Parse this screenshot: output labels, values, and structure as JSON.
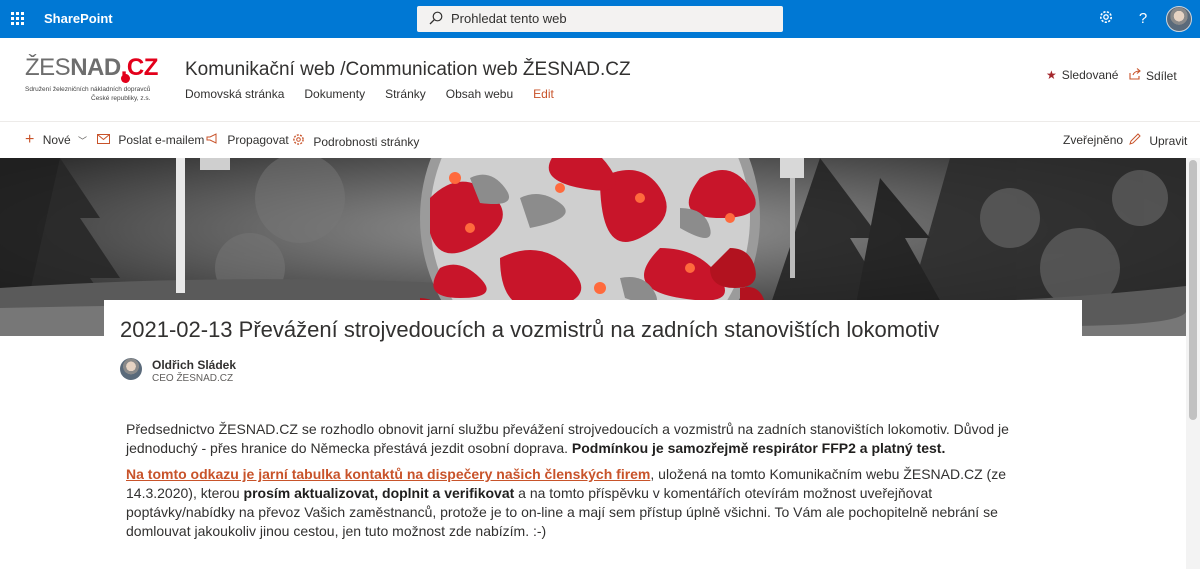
{
  "suite_bar": {
    "brand": "SharePoint",
    "search_placeholder": "Prohledat tento web",
    "settings_icon": "gear-icon",
    "help_label": "?",
    "color": "#0078d4"
  },
  "site": {
    "logo": {
      "main_a": "ŽES",
      "main_b": "NAD",
      "main_c": ".CZ",
      "subtitle_line1": "Sdružení železničních nákladních dopravců",
      "subtitle_line2": "České republiky, z.s."
    },
    "title": "Komunikační web /Communication web ŽESNAD.CZ",
    "nav": [
      "Domovská stránka",
      "Dokumenty",
      "Stránky",
      "Obsah webu"
    ],
    "nav_edit": "Edit",
    "follow_label": "Sledované",
    "share_label": "Sdílet"
  },
  "command_bar": {
    "new_label": "Nové",
    "email_label": "Poslat e-mailem",
    "promote_label": "Propagovat",
    "details_label": "Podrobnosti stránky",
    "published_label": "Zveřejněno",
    "edit_label": "Upravit"
  },
  "article": {
    "title": "2021-02-13 Převážení strojvedoucích a vozmistrů na zadních stanovištích lokomotiv",
    "author_name": "Oldřich Sládek",
    "author_role": "CEO ŽESNAD.CZ",
    "p1_text": "Předsednictvo ŽESNAD.CZ se rozhodlo obnovit jarní službu převážení strojvedoucích a vozmistrů na zadních stanovištích lokomotiv. Důvod je jednoduchý - přes hranice do Německa přestává jezdit osobní doprava. ",
    "p1_bold": "Podmínkou je samozřejmě respirátor FFP2 a platný test.",
    "p2_link": "Na tomto odkazu je jarní tabulka kontaktů na dispečery našich členských firem",
    "p2_text1": ", uložená na tomto Komunikačním webu ŽESNAD.CZ (ze 14.3.2020), kterou ",
    "p2_bold": "prosím aktualizovat, doplnit a verifikovat",
    "p2_text2": " a na tomto příspěvku v komentářích otevírám možnost uveřejňovat poptávky/nabídky na převoz Vašich zaměstnanců, protože je to on-line a mají sem přístup úplně všichni. To Vám ale pochopitelně nebrání se domlouvat jakoukoliv jinou cestou, jen tuto možnost zde nabízím. :-)"
  },
  "colors": {
    "accent": "#c8532a",
    "brand_red": "#e3001b"
  }
}
